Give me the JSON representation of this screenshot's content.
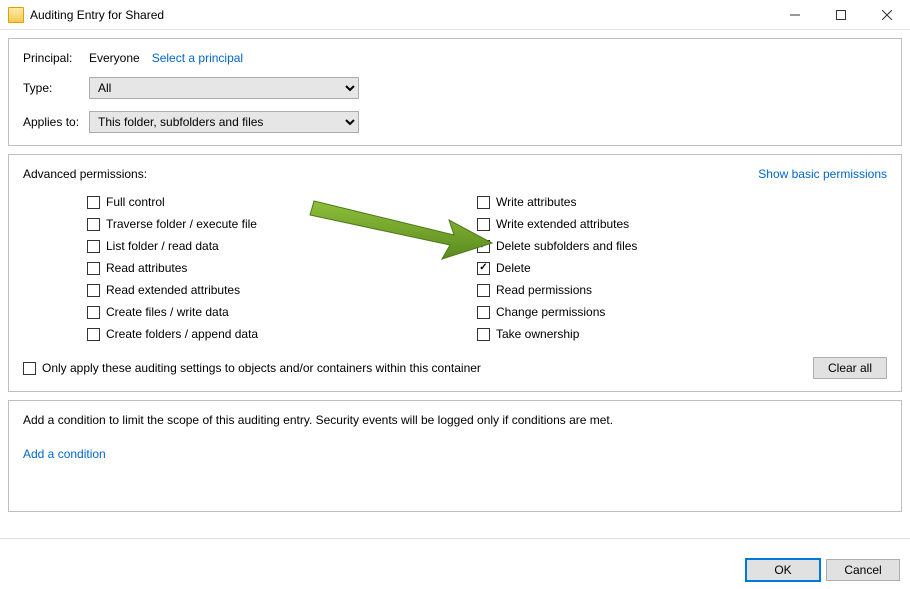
{
  "window": {
    "title": "Auditing Entry for Shared"
  },
  "principal": {
    "label": "Principal:",
    "value": "Everyone",
    "select_link": "Select a principal"
  },
  "type": {
    "label": "Type:",
    "value": "All"
  },
  "applies_to": {
    "label": "Applies to:",
    "value": "This folder, subfolders and files"
  },
  "permissions": {
    "title": "Advanced permissions:",
    "show_basic_link": "Show basic permissions",
    "left": [
      {
        "label": "Full control",
        "checked": false
      },
      {
        "label": "Traverse folder / execute file",
        "checked": false
      },
      {
        "label": "List folder / read data",
        "checked": false
      },
      {
        "label": "Read attributes",
        "checked": false
      },
      {
        "label": "Read extended attributes",
        "checked": false
      },
      {
        "label": "Create files / write data",
        "checked": false
      },
      {
        "label": "Create folders / append data",
        "checked": false
      }
    ],
    "right": [
      {
        "label": "Write attributes",
        "checked": false
      },
      {
        "label": "Write extended attributes",
        "checked": false
      },
      {
        "label": "Delete subfolders and files",
        "checked": true
      },
      {
        "label": "Delete",
        "checked": true
      },
      {
        "label": "Read permissions",
        "checked": false
      },
      {
        "label": "Change permissions",
        "checked": false
      },
      {
        "label": "Take ownership",
        "checked": false
      }
    ],
    "only_apply": {
      "label": "Only apply these auditing settings to objects and/or containers within this container",
      "checked": false
    },
    "clear_all": "Clear all"
  },
  "condition": {
    "text": "Add a condition to limit the scope of this auditing entry. Security events will be logged only if conditions are met.",
    "add_link": "Add a condition"
  },
  "buttons": {
    "ok": "OK",
    "cancel": "Cancel"
  }
}
